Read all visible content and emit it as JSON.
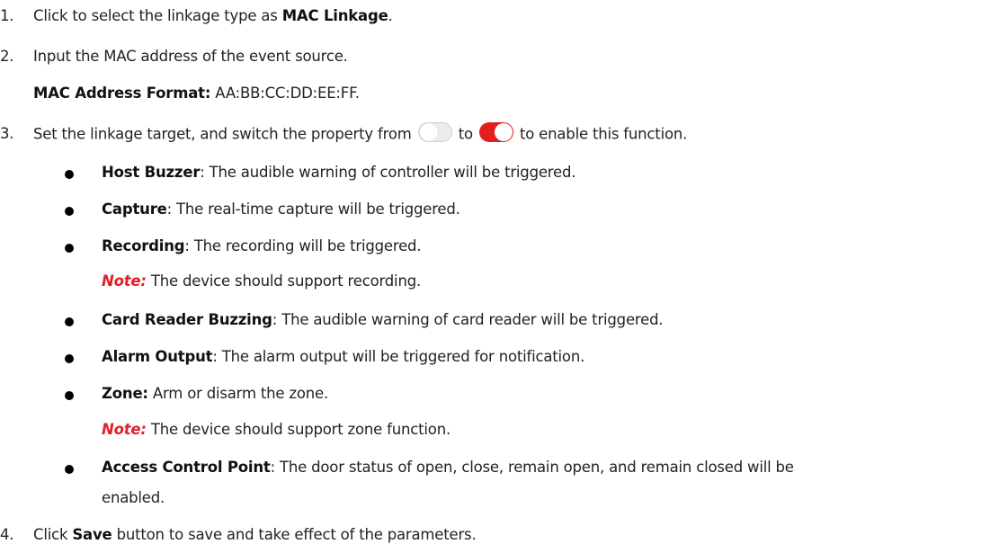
{
  "steps": [
    {
      "num": "1.",
      "pre": "Click to select the linkage type as ",
      "bold": "MAC Linkage",
      "post": "."
    },
    {
      "num": "2.",
      "text": "Input the MAC address of the event source."
    },
    {
      "format_label": "MAC Address Format:",
      "format_value": " AA:BB:CC:DD:EE:FF."
    },
    {
      "num": "3.",
      "pre": "Set the linkage target, and switch the property from",
      "mid": "to",
      "post": "to enable this function."
    },
    {
      "num": "4.",
      "pre": "Click ",
      "bold": "Save",
      "post": " button to save and take effect of the parameters."
    }
  ],
  "bullets": [
    {
      "bold": "Host Buzzer",
      "text": ": The audible warning of controller will be triggered."
    },
    {
      "bold": "Capture",
      "text": ": The real-time capture will be triggered."
    },
    {
      "bold": "Recording",
      "text": ": The recording will be triggered."
    },
    {
      "bold": "Card Reader Buzzing",
      "text": ": The audible warning of card reader will be triggered."
    },
    {
      "bold": "Alarm Output",
      "text": ": The alarm output will be triggered for notification."
    },
    {
      "bold": "Zone:",
      "text": " Arm or disarm the zone."
    },
    {
      "bold": "Access Control Point",
      "text": ": The door status of open, close, remain open, and remain closed will be",
      "text2": "enabled."
    }
  ],
  "notes": [
    {
      "label": "Note:",
      "text": " The device should support recording."
    },
    {
      "label": "Note:",
      "text": " The device should support zone function."
    }
  ],
  "toggles": {
    "off_state": "off",
    "on_state": "on",
    "on_color": "#e21e1e"
  }
}
